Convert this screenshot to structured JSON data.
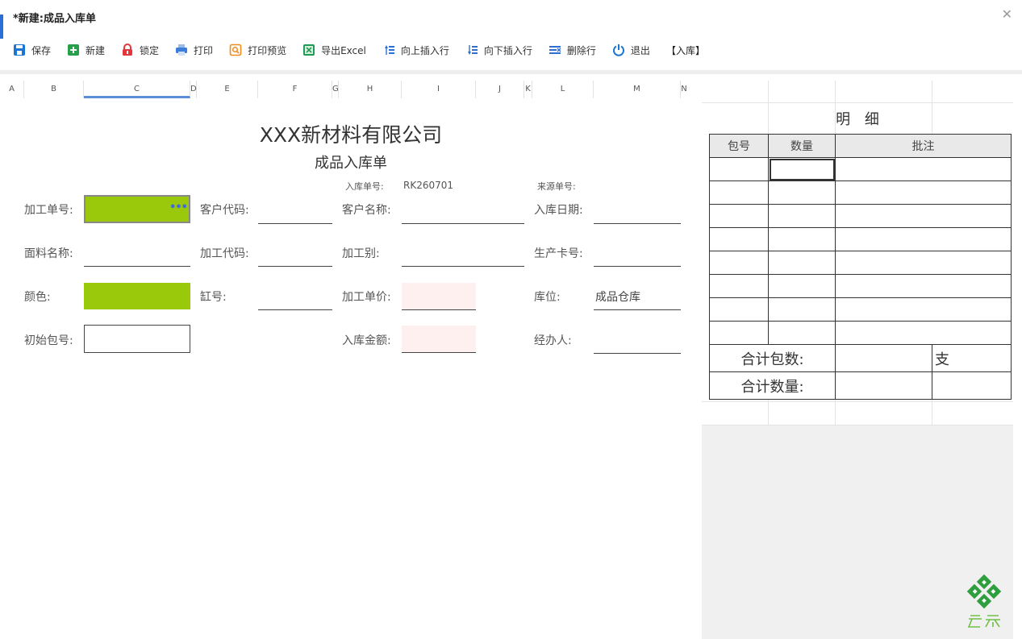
{
  "window": {
    "title": "*新建:成品入库单"
  },
  "toolbar": {
    "items": [
      {
        "label": "保存",
        "icon": "save-icon",
        "color": "#1a76d2"
      },
      {
        "label": "新建",
        "icon": "new-doc-icon",
        "color": "#27a04a"
      },
      {
        "label": "锁定",
        "icon": "lock-icon",
        "color": "#e5363d"
      },
      {
        "label": "打印",
        "icon": "printer-icon",
        "color": "#3b7dd8"
      },
      {
        "label": "打印预览",
        "icon": "print-preview-icon",
        "color": "#f08a1c"
      },
      {
        "label": "导出Excel",
        "icon": "excel-icon",
        "color": "#1f9b54"
      },
      {
        "label": "向上插入行",
        "icon": "insert-row-above-icon",
        "color": "#2f6fd1"
      },
      {
        "label": "向下插入行",
        "icon": "insert-row-below-icon",
        "color": "#2f6fd1"
      },
      {
        "label": "删除行",
        "icon": "delete-row-icon",
        "color": "#2f6fd1"
      },
      {
        "label": "退出",
        "icon": "power-icon",
        "color": "#1a76d2"
      }
    ],
    "mode_label": "【入库】"
  },
  "sheet": {
    "columns": [
      "A",
      "B",
      "C",
      "D",
      "E",
      "F",
      "G",
      "H",
      "I",
      "J",
      "K",
      "L",
      "M",
      "N"
    ]
  },
  "form": {
    "company": "XXX新材料有限公司",
    "doc_name": "成品入库单",
    "doc_no_label": "入库单号:",
    "doc_no_value": "RK260701",
    "source_no_label": "来源单号:",
    "process_no_label": "加工单号:",
    "customer_code_label": "客户代码:",
    "customer_name_label": "客户名称:",
    "in_date_label": "入库日期:",
    "fabric_name_label": "面料名称:",
    "process_code_label": "加工代码:",
    "process_type_label": "加工别:",
    "prod_card_label": "生产卡号:",
    "color_label": "颜色:",
    "vat_no_label": "缸号:",
    "unit_price_label": "加工单价:",
    "location_label": "库位:",
    "location_value": "成品仓库",
    "init_pack_label": "初始包号:",
    "amount_label": "入库金额:",
    "handler_label": "经办人:"
  },
  "detail": {
    "title": "明 细",
    "headers": [
      "包号",
      "数量",
      "批注"
    ],
    "total_packs_label": "合计包数:",
    "total_packs_unit": "支",
    "total_qty_label": "合计数量:"
  },
  "colors": {
    "field_green": "#99c90a",
    "field_pink": "#fdf0ef",
    "accent": "#5b8ed6",
    "logo_green": "#2e9e3e"
  }
}
